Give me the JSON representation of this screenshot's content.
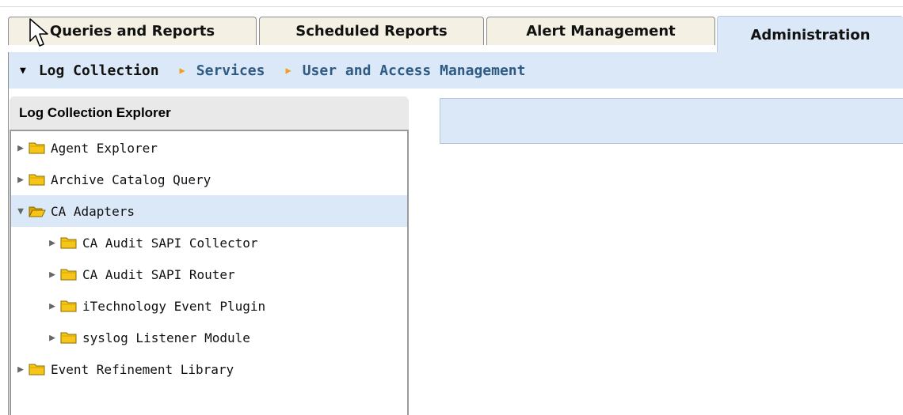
{
  "tabs": [
    {
      "label": "Queries and Reports",
      "active": false
    },
    {
      "label": "Scheduled Reports",
      "active": false
    },
    {
      "label": "Alert Management",
      "active": false
    },
    {
      "label": "Administration",
      "active": true
    }
  ],
  "subnav": {
    "items": [
      "Log Collection",
      "Services",
      "User and Access Management"
    ]
  },
  "explorer": {
    "title": "Log Collection Explorer",
    "items": [
      {
        "label": "Agent Explorer",
        "level": 0,
        "expanded": false,
        "selected": false
      },
      {
        "label": "Archive Catalog Query",
        "level": 0,
        "expanded": false,
        "selected": false
      },
      {
        "label": "CA Adapters",
        "level": 0,
        "expanded": true,
        "selected": true
      },
      {
        "label": "CA Audit SAPI Collector",
        "level": 1,
        "expanded": false,
        "selected": false
      },
      {
        "label": "CA Audit SAPI Router",
        "level": 1,
        "expanded": false,
        "selected": false
      },
      {
        "label": "iTechnology Event Plugin",
        "level": 1,
        "expanded": false,
        "selected": false
      },
      {
        "label": "syslog Listener Module",
        "level": 1,
        "expanded": false,
        "selected": false
      },
      {
        "label": "Event Refinement Library",
        "level": 0,
        "expanded": false,
        "selected": false
      }
    ]
  },
  "colors": {
    "active_tab": "#dbe8f7",
    "inactive_tab": "#f4f0e4",
    "link": "#2f5a84",
    "separator": "#f0a020",
    "folder": "#f5c518"
  },
  "icons": {
    "folder": "folder-icon",
    "expand": "triangle-right-icon",
    "collapse": "triangle-down-icon",
    "cursor": "mouse-pointer-icon"
  }
}
